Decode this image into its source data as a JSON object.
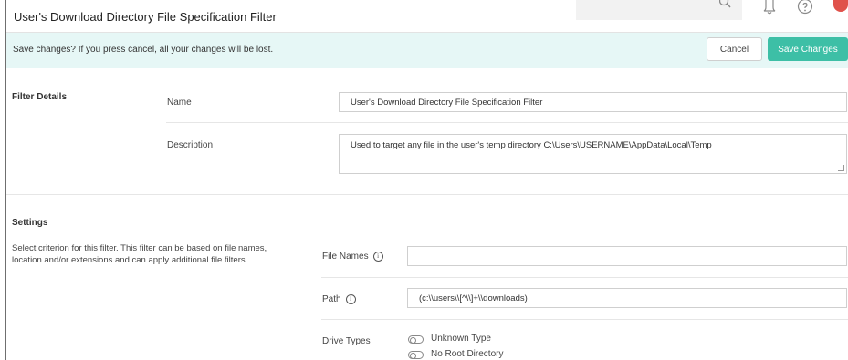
{
  "header": {
    "title": "User's Download Directory File Specification Filter",
    "icons": [
      "search-icon",
      "bell-icon",
      "help-icon",
      "alert-icon"
    ]
  },
  "save_bar": {
    "message": "Save changes? If you press cancel, all your changes will be lost.",
    "cancel_label": "Cancel",
    "save_label": "Save Changes",
    "accent": "#3dbfa6",
    "background": "#e6f7f6"
  },
  "filter_details": {
    "section_label": "Filter Details",
    "name_label": "Name",
    "name_value": "User's Download Directory File Specification Filter",
    "description_label": "Description",
    "description_value": "Used to target any file in the user's temp directory C:\\Users\\USERNAME\\AppData\\Local\\Temp"
  },
  "settings": {
    "section_label": "Settings",
    "description": "Select criterion for this filter. This filter can be based on file names, location and/or extensions and can apply additional file filters.",
    "file_names_label": "File Names",
    "file_names_value": "",
    "path_label": "Path",
    "path_value": "(c:\\\\users\\\\[^\\\\]+\\\\downloads)",
    "drive_types_label": "Drive Types",
    "drive_types": [
      "Unknown Type",
      "No Root Directory"
    ]
  }
}
